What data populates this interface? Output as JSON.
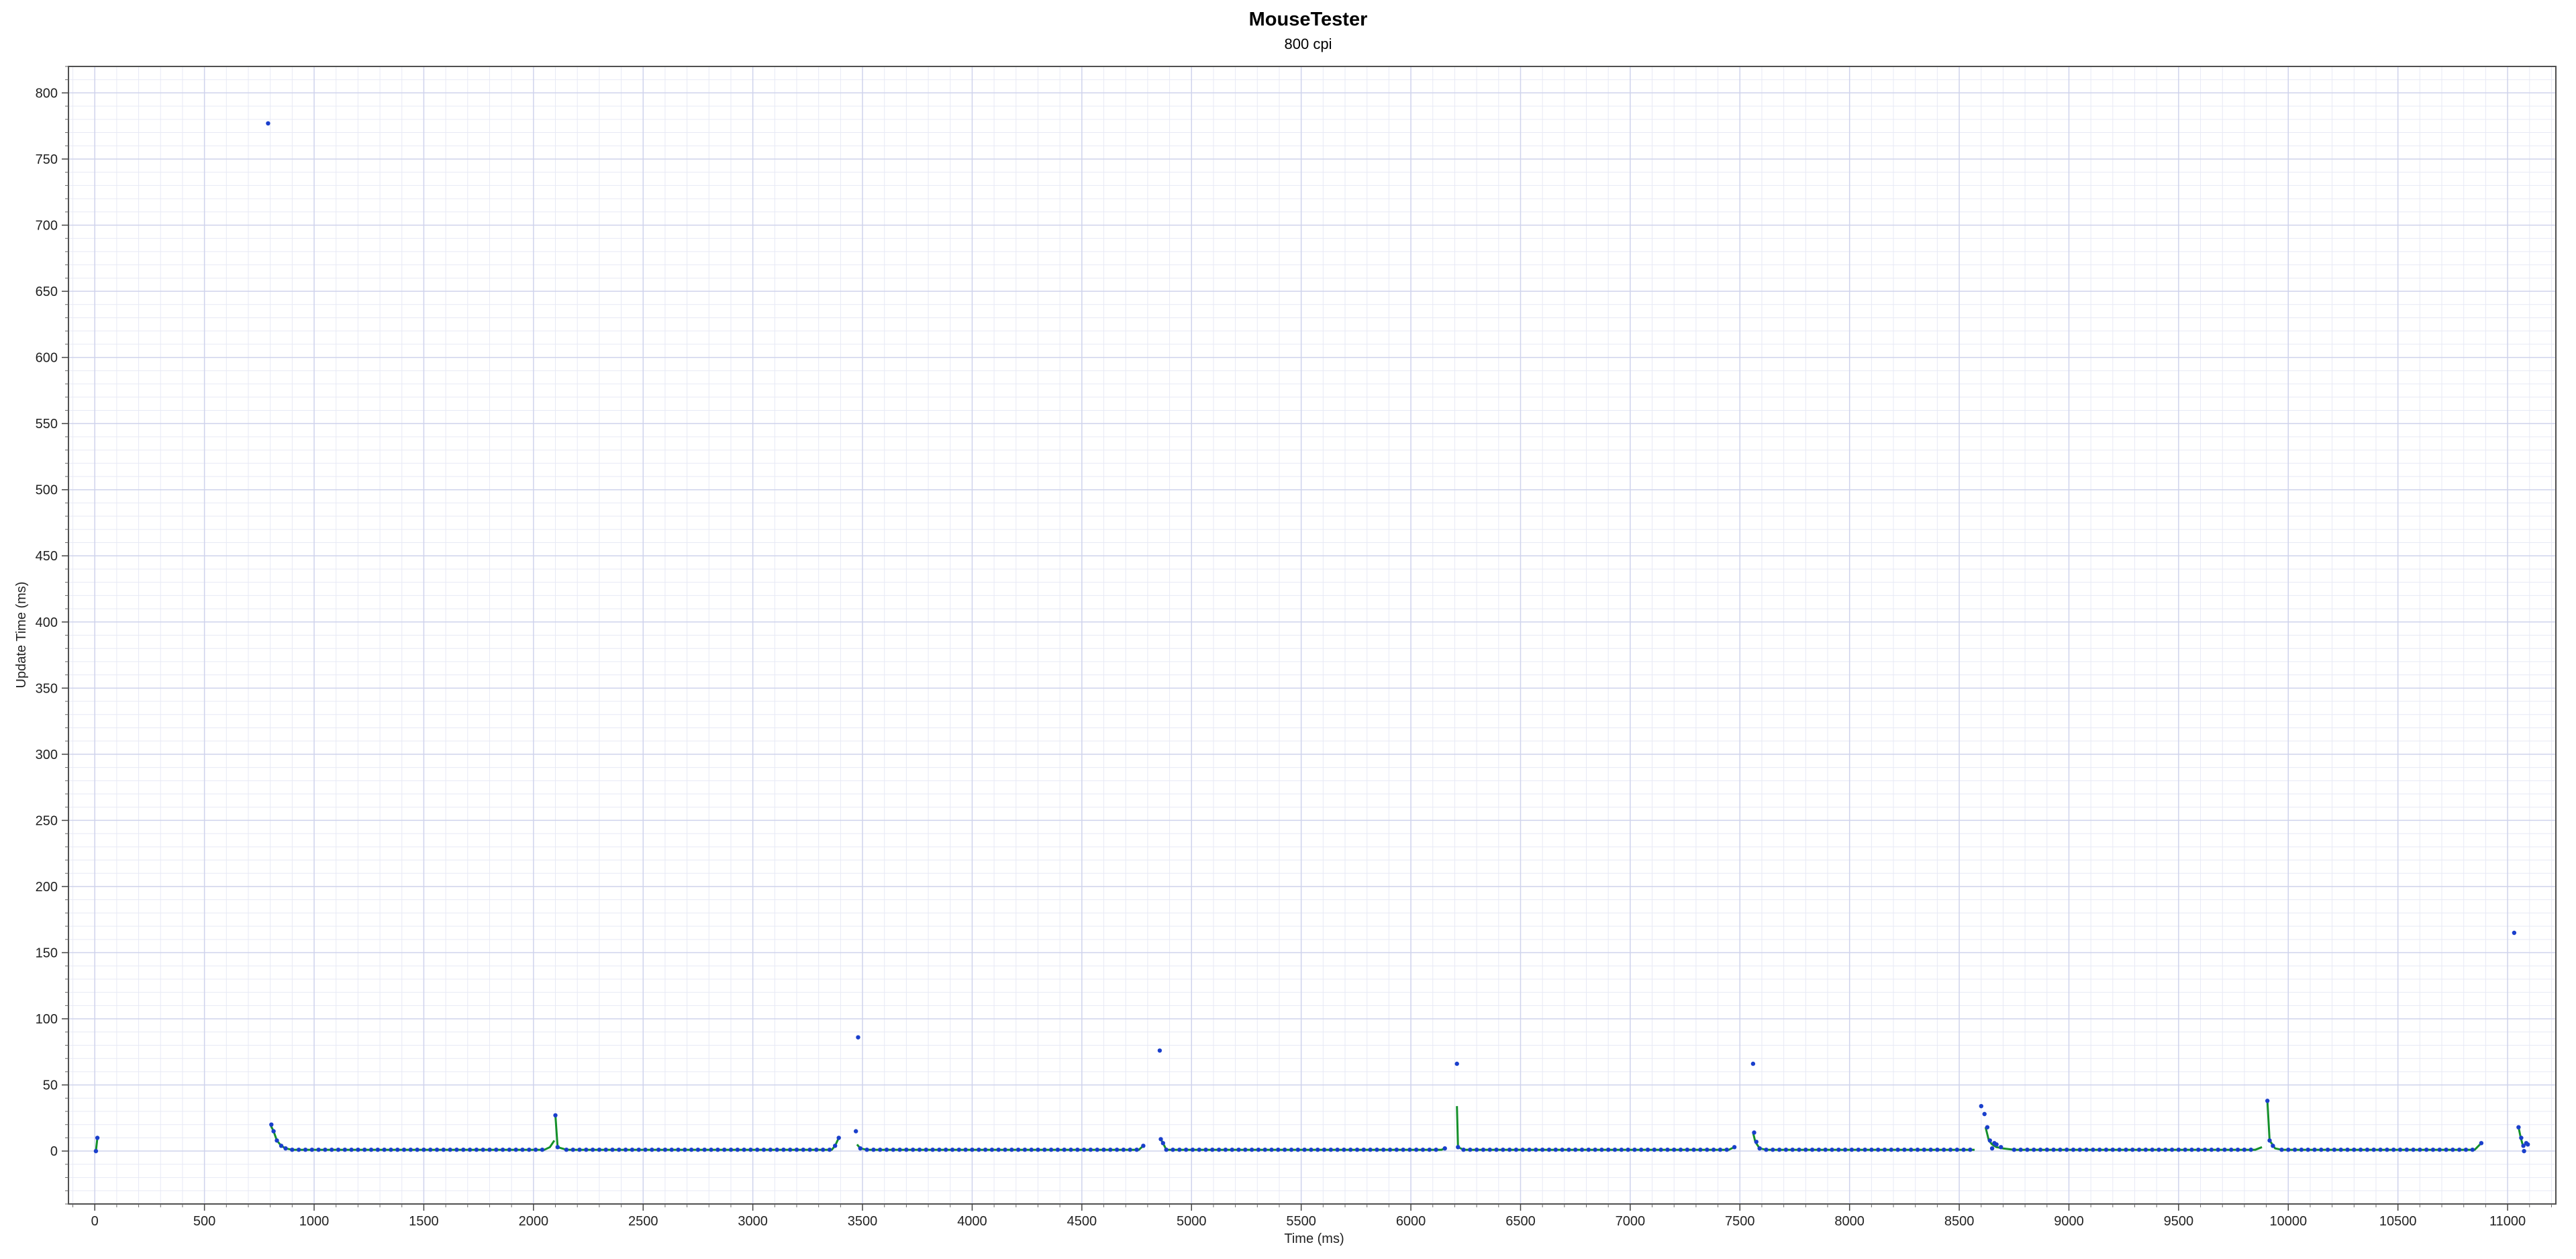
{
  "chart_data": {
    "type": "scatter",
    "title": "MouseTester",
    "subtitle": "800 cpi",
    "xlabel": "Time (ms)",
    "ylabel": "Update Time (ms)",
    "xlim": [
      -120,
      11220
    ],
    "ylim": [
      -40,
      820
    ],
    "x_ticks": [
      0,
      500,
      1000,
      1500,
      2000,
      2500,
      3000,
      3500,
      4000,
      4500,
      5000,
      5500,
      6000,
      6500,
      7000,
      7500,
      8000,
      8500,
      9000,
      9500,
      10000,
      10500,
      11000
    ],
    "y_ticks": [
      0,
      50,
      100,
      150,
      200,
      250,
      300,
      350,
      400,
      450,
      500,
      550,
      600,
      650,
      700,
      750,
      800
    ],
    "x_minor_step": 100,
    "y_minor_step": 10,
    "grid": true,
    "legend": "none",
    "colors": {
      "points": "#1a3fcc",
      "line": "#14902a",
      "grid_major": "#cfd3ec",
      "grid_minor": "#e7e9f5",
      "frame": "#505050"
    },
    "series": [
      {
        "type": "line",
        "segments": [
          [
            [
              5,
              0
            ],
            [
              12,
              10
            ]
          ],
          [
            [
              800,
              20
            ],
            [
              815,
              15
            ],
            [
              830,
              8
            ],
            [
              850,
              4
            ],
            [
              870,
              2
            ],
            [
              900,
              1
            ],
            [
              2050,
              1
            ],
            [
              2075,
              3
            ],
            [
              2095,
              8
            ]
          ],
          [
            [
              2100,
              27
            ],
            [
              2110,
              3
            ],
            [
              2150,
              1
            ],
            [
              3360,
              1
            ],
            [
              3375,
              4
            ],
            [
              3392,
              10
            ]
          ],
          [
            [
              3475,
              5
            ],
            [
              3490,
              2
            ],
            [
              3520,
              1
            ],
            [
              4760,
              1
            ],
            [
              4780,
              4
            ]
          ],
          [
            [
              4860,
              9
            ],
            [
              4870,
              6
            ],
            [
              4885,
              1
            ],
            [
              6140,
              1
            ],
            [
              6155,
              2
            ]
          ],
          [
            [
              6210,
              34
            ],
            [
              6215,
              3
            ],
            [
              6240,
              1
            ],
            [
              7450,
              1
            ],
            [
              7475,
              3
            ]
          ],
          [
            [
              7560,
              14
            ],
            [
              7570,
              7
            ],
            [
              7590,
              2
            ],
            [
              7620,
              1
            ],
            [
              8570,
              1
            ]
          ],
          [
            [
              8620,
              18
            ],
            [
              8635,
              8
            ],
            [
              8650,
              5
            ],
            [
              8670,
              3
            ],
            [
              8700,
              2
            ],
            [
              8750,
              1
            ],
            [
              9850,
              1
            ],
            [
              9880,
              3
            ]
          ],
          [
            [
              9905,
              38
            ],
            [
              9915,
              8
            ],
            [
              9940,
              2
            ],
            [
              9970,
              1
            ],
            [
              10850,
              1
            ],
            [
              10880,
              6
            ]
          ],
          [
            [
              11050,
              18
            ],
            [
              11060,
              10
            ],
            [
              11070,
              4
            ],
            [
              11090,
              6
            ]
          ]
        ]
      },
      {
        "type": "scatter",
        "points": [
          [
            5,
            0
          ],
          [
            12,
            10
          ],
          [
            790,
            777
          ],
          [
            805,
            20
          ],
          [
            815,
            15
          ],
          [
            830,
            8
          ],
          [
            850,
            4
          ],
          [
            870,
            2
          ],
          [
            2100,
            27
          ],
          [
            2110,
            3
          ],
          [
            3375,
            4
          ],
          [
            3392,
            10
          ],
          [
            3470,
            15
          ],
          [
            3480,
            86
          ],
          [
            3490,
            2
          ],
          [
            4780,
            4
          ],
          [
            4855,
            76
          ],
          [
            4860,
            9
          ],
          [
            4870,
            6
          ],
          [
            6155,
            2
          ],
          [
            6210,
            66
          ],
          [
            6215,
            3
          ],
          [
            7475,
            3
          ],
          [
            7560,
            66
          ],
          [
            7565,
            14
          ],
          [
            7575,
            7
          ],
          [
            7590,
            2
          ],
          [
            8600,
            34
          ],
          [
            8615,
            28
          ],
          [
            8628,
            18
          ],
          [
            8640,
            8
          ],
          [
            8650,
            2
          ],
          [
            8660,
            6
          ],
          [
            8670,
            5
          ],
          [
            8690,
            3
          ],
          [
            9905,
            38
          ],
          [
            9915,
            8
          ],
          [
            9930,
            4
          ],
          [
            10880,
            6
          ],
          [
            11030,
            165
          ],
          [
            11050,
            18
          ],
          [
            11062,
            10
          ],
          [
            11072,
            4
          ],
          [
            11075,
            0
          ],
          [
            11085,
            6
          ],
          [
            11092,
            5
          ]
        ],
        "dense_runs": [
          [
            900,
            2050,
            1
          ],
          [
            2150,
            3360,
            1
          ],
          [
            3520,
            4760,
            1
          ],
          [
            4885,
            6140,
            1
          ],
          [
            6240,
            7450,
            1
          ],
          [
            7620,
            8570,
            1
          ],
          [
            8750,
            9850,
            1
          ],
          [
            9970,
            10850,
            1
          ]
        ],
        "dense_step": 30
      }
    ]
  }
}
